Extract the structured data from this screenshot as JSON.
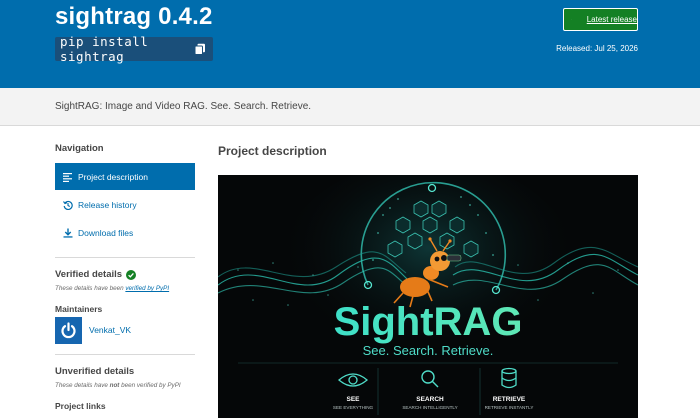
{
  "header": {
    "package_title": "sightrag 0.4.2",
    "pip_command": "pip install sightrag",
    "latest_release_label": "Latest release",
    "released_text": "Released: Jul 25, 2026"
  },
  "summary": "SightRAG: Image and Video RAG. See. Search. Retrieve.",
  "sidebar": {
    "navigation_heading": "Navigation",
    "nav_items": [
      {
        "label": "Project description",
        "icon": "align-left-icon",
        "active": true
      },
      {
        "label": "Release history",
        "icon": "history-icon",
        "active": false
      },
      {
        "label": "Download files",
        "icon": "download-icon",
        "active": false
      }
    ],
    "verified_heading": "Verified details",
    "verified_note_prefix": "These details have been ",
    "verified_note_link": "verified by PyPI",
    "maintainers_heading": "Maintainers",
    "maintainer_name": "Venkat_VK",
    "unverified_heading": "Unverified details",
    "unverified_note_prefix": "These details have ",
    "unverified_note_bold": "not",
    "unverified_note_suffix": " been verified by PyPI",
    "project_links_heading": "Project links"
  },
  "main": {
    "section_title": "Project description",
    "banner": {
      "logo_text": "SightRAG",
      "tagline": "See. Search. Retrieve.",
      "features": [
        {
          "title": "SEE",
          "subtitle": "SEE EVERYTHING",
          "icon": "eye-icon"
        },
        {
          "title": "SEARCH",
          "subtitle": "SEARCH INTELLIGENTLY",
          "icon": "magnifier-icon"
        },
        {
          "title": "RETRIEVE",
          "subtitle": "RETRIEVE INSTANTLY",
          "icon": "database-icon"
        }
      ]
    }
  },
  "colors": {
    "header_blue": "#006dad",
    "release_green": "#148024",
    "banner_teal": "#3fd6c4",
    "ant_orange": "#f08a24"
  }
}
